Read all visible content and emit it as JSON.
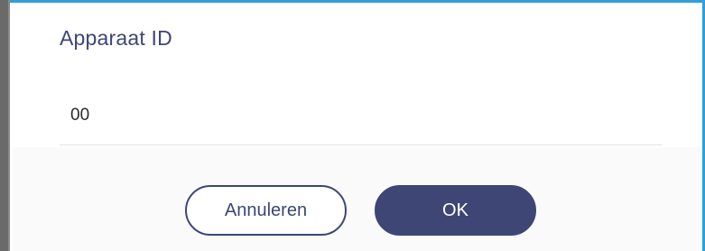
{
  "dialog": {
    "title": "Apparaat ID",
    "field_value": "00",
    "cancel_label": "Annuleren",
    "ok_label": "OK"
  },
  "colors": {
    "accent": "#3d4675",
    "frame_highlight": "#2e9fd8",
    "divider": "#e3e3e3"
  }
}
